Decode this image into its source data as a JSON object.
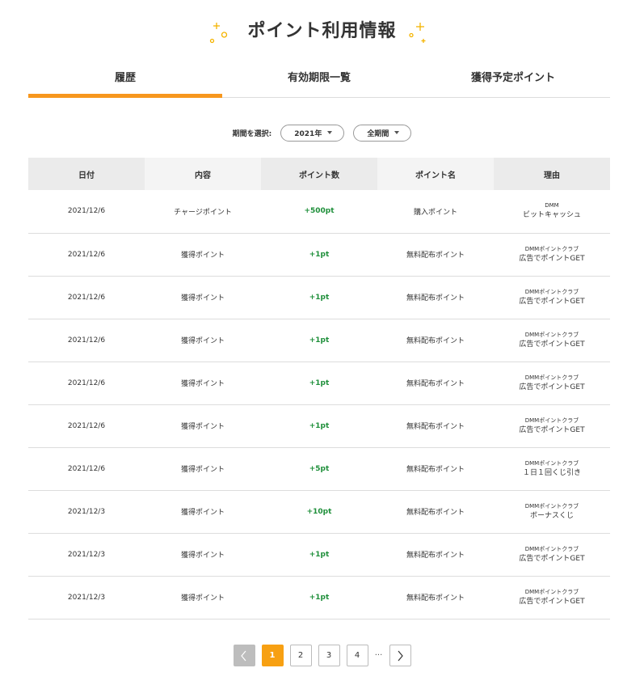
{
  "header": {
    "title": "ポイント利用情報"
  },
  "tabs": [
    {
      "label": "履歴",
      "active": true
    },
    {
      "label": "有効期限一覧",
      "active": false
    },
    {
      "label": "獲得予定ポイント",
      "active": false
    }
  ],
  "filter": {
    "label": "期間を選択:",
    "year": "2021年",
    "period": "全期間"
  },
  "table": {
    "headers": [
      "日付",
      "内容",
      "ポイント数",
      "ポイント名",
      "理由"
    ],
    "rows": [
      {
        "date": "2021/12/6",
        "content": "チャージポイント",
        "points": "+500pt",
        "name": "購入ポイント",
        "reason1": "DMM",
        "reason2": "ビットキャッシュ"
      },
      {
        "date": "2021/12/6",
        "content": "獲得ポイント",
        "points": "+1pt",
        "name": "無料配布ポイント",
        "reason1": "DMMポイントクラブ",
        "reason2": "広告でポイントGET"
      },
      {
        "date": "2021/12/6",
        "content": "獲得ポイント",
        "points": "+1pt",
        "name": "無料配布ポイント",
        "reason1": "DMMポイントクラブ",
        "reason2": "広告でポイントGET"
      },
      {
        "date": "2021/12/6",
        "content": "獲得ポイント",
        "points": "+1pt",
        "name": "無料配布ポイント",
        "reason1": "DMMポイントクラブ",
        "reason2": "広告でポイントGET"
      },
      {
        "date": "2021/12/6",
        "content": "獲得ポイント",
        "points": "+1pt",
        "name": "無料配布ポイント",
        "reason1": "DMMポイントクラブ",
        "reason2": "広告でポイントGET"
      },
      {
        "date": "2021/12/6",
        "content": "獲得ポイント",
        "points": "+1pt",
        "name": "無料配布ポイント",
        "reason1": "DMMポイントクラブ",
        "reason2": "広告でポイントGET"
      },
      {
        "date": "2021/12/6",
        "content": "獲得ポイント",
        "points": "+5pt",
        "name": "無料配布ポイント",
        "reason1": "DMMポイントクラブ",
        "reason2": "１日１回くじ引き"
      },
      {
        "date": "2021/12/3",
        "content": "獲得ポイント",
        "points": "+10pt",
        "name": "無料配布ポイント",
        "reason1": "DMMポイントクラブ",
        "reason2": "ボーナスくじ"
      },
      {
        "date": "2021/12/3",
        "content": "獲得ポイント",
        "points": "+1pt",
        "name": "無料配布ポイント",
        "reason1": "DMMポイントクラブ",
        "reason2": "広告でポイントGET"
      },
      {
        "date": "2021/12/3",
        "content": "獲得ポイント",
        "points": "+1pt",
        "name": "無料配布ポイント",
        "reason1": "DMMポイントクラブ",
        "reason2": "広告でポイントGET"
      }
    ]
  },
  "pagination": {
    "pages": [
      "1",
      "2",
      "3",
      "4"
    ],
    "current": "1",
    "ellipsis": "···"
  },
  "colors": {
    "accent": "#f7971e",
    "points_green": "#1e8f3a",
    "page_current": "#f7a012"
  },
  "icons": {
    "decoration": "sparkle-icon",
    "prev": "chevron-left-icon",
    "next": "chevron-right-icon",
    "dropdown": "caret-down-icon"
  }
}
